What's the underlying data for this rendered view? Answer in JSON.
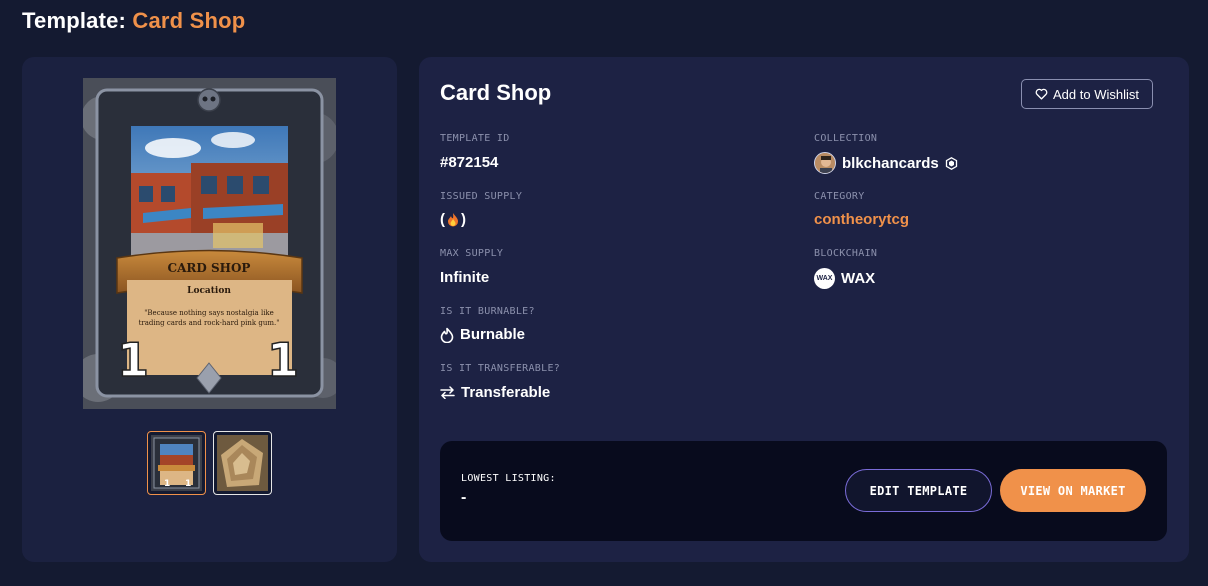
{
  "header": {
    "title_prefix": "Template:",
    "title_name": "Card Shop"
  },
  "card": {
    "name": "CARD SHOP",
    "type": "Location",
    "flavor": "\"Because nothing says nostalgia like trading cards and rock-hard pink gum.\"",
    "left_stat": "1",
    "right_stat": "1"
  },
  "details": {
    "name": "Card Shop",
    "wishlist_label": "Add to Wishlist",
    "template_id": {
      "label": "TEMPLATE ID",
      "value": "#872154"
    },
    "issued_supply": {
      "label": "ISSUED SUPPLY",
      "open": "(",
      "close": ")"
    },
    "max_supply": {
      "label": "MAX SUPPLY",
      "value": "Infinite"
    },
    "burnable": {
      "label": "IS IT BURNABLE?",
      "value": "Burnable"
    },
    "transferable": {
      "label": "IS IT TRANSFERABLE?",
      "value": "Transferable"
    },
    "collection": {
      "label": "COLLECTION",
      "value": "blkchancards"
    },
    "category": {
      "label": "CATEGORY",
      "value": "contheorytcg"
    },
    "blockchain": {
      "label": "BLOCKCHAIN",
      "value": "WAX",
      "logo_text": "WAX"
    }
  },
  "listing": {
    "label": "LOWEST LISTING:",
    "value": "-",
    "edit_label": "EDIT TEMPLATE",
    "market_label": "VIEW ON MARKET"
  },
  "colors": {
    "accent": "#f0914a",
    "background": "#141a31",
    "panel": "#1d2244",
    "listing_bg": "#080b1d"
  },
  "icons": [
    "heart-icon",
    "fire-icon",
    "flame-outline-icon",
    "transfer-arrows-icon",
    "verified-badge-icon",
    "wax-logo"
  ]
}
